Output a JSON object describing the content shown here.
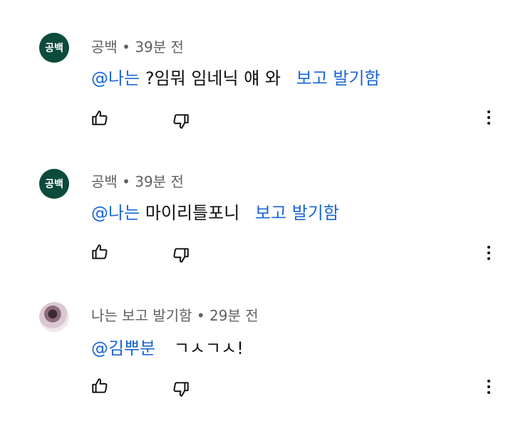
{
  "comments": [
    {
      "avatar_text": "공백",
      "author": "공백",
      "separator": " • ",
      "time": "39분 전",
      "mention": "@나는",
      "text": "?임뭐 임네닉 얘 와",
      "link": "보고 발기함"
    },
    {
      "avatar_text": "공백",
      "author": "공백",
      "separator": " • ",
      "time": "39분 전",
      "mention": "@나는",
      "text": "마이리틀포니",
      "link": "보고 발기함"
    },
    {
      "avatar_text": "",
      "author": "나는 보고 발기함",
      "separator": " • ",
      "time": "29분 전",
      "mention": "@김뿌분",
      "text": "ㄱㅅㄱㅅ!",
      "link": ""
    }
  ],
  "icons": {
    "like": "thumbs-up-icon",
    "dislike": "thumbs-down-icon",
    "more": "more-vertical-icon"
  },
  "colors": {
    "mention": "#1a66d6",
    "avatar_green": "#0c4a3b",
    "meta_gray": "#606060"
  }
}
